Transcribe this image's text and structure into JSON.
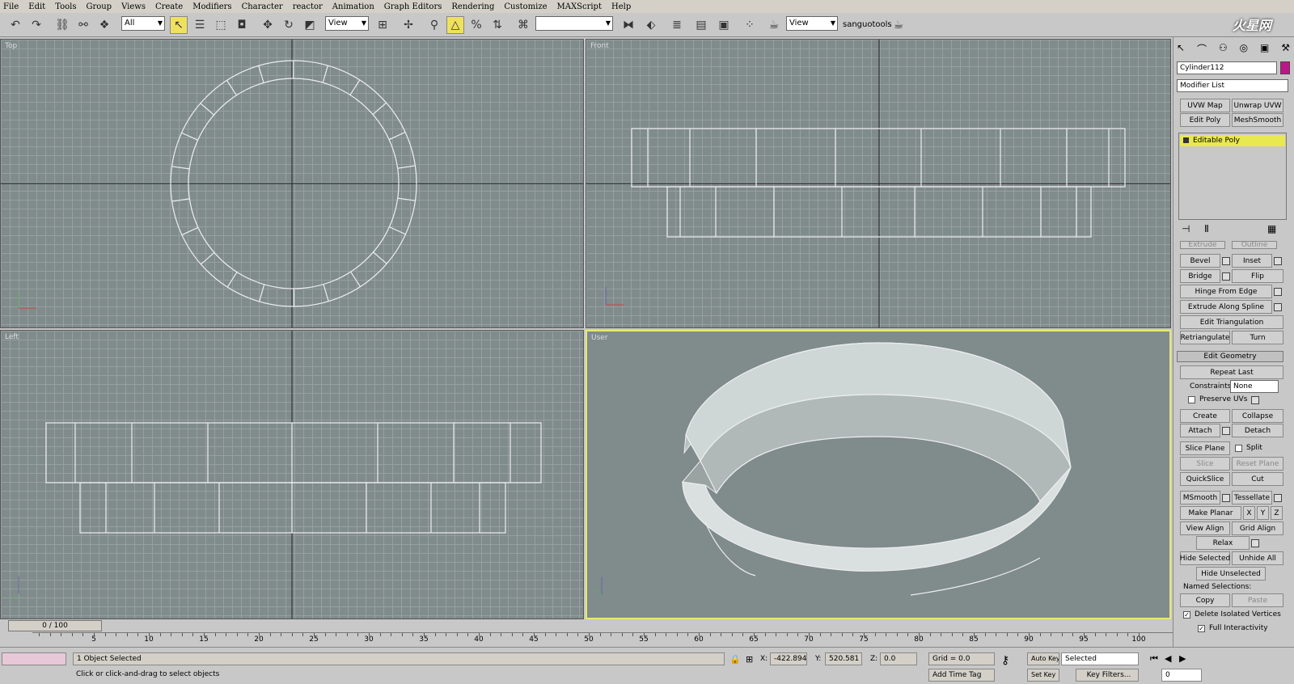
{
  "menu": [
    "File",
    "Edit",
    "Tools",
    "Group",
    "Views",
    "Create",
    "Modifiers",
    "Character",
    "reactor",
    "Animation",
    "Graph Editors",
    "Rendering",
    "Customize",
    "MAXScript",
    "Help"
  ],
  "toolbar": {
    "selection_filter": "All",
    "ref_coord": "View",
    "named_sel": "",
    "render_view": "View",
    "user": "sanguotools"
  },
  "logo_text": "火星网",
  "viewports": {
    "top": "Top",
    "front": "Front",
    "left": "Left",
    "user": "User"
  },
  "command_panel": {
    "object_name": "Cylinder112",
    "object_color": "#c0158a",
    "modifier_list": "Modifier List",
    "modifier_buttons": [
      "UVW Map",
      "Unwrap UVW",
      "Edit Poly",
      "MeshSmooth"
    ],
    "stack_item": "Editable Poly",
    "edit_edges": {
      "row0": [
        "Extrude",
        "Outline"
      ],
      "bevel": "Bevel",
      "inset": "Inset",
      "bridge": "Bridge",
      "flip": "Flip",
      "hinge": "Hinge From Edge",
      "extrude_spline": "Extrude Along Spline",
      "edit_tri": "Edit Triangulation",
      "retriangulate": "Retriangulate",
      "turn": "Turn"
    },
    "edit_geometry": {
      "header": "Edit Geometry",
      "repeat_last": "Repeat Last",
      "constraints_label": "Constraints:",
      "constraints_value": "None",
      "preserve_uvs": "Preserve UVs",
      "create": "Create",
      "collapse": "Collapse",
      "attach": "Attach",
      "detach": "Detach",
      "slice_plane": "Slice Plane",
      "split": "Split",
      "slice": "Slice",
      "reset_plane": "Reset Plane",
      "quickslice": "QuickSlice",
      "cut": "Cut",
      "msmooth": "MSmooth",
      "tessellate": "Tessellate",
      "make_planar": "Make Planar",
      "axes": [
        "X",
        "Y",
        "Z"
      ],
      "view_align": "View Align",
      "grid_align": "Grid Align",
      "relax": "Relax",
      "hide_selected": "Hide Selected",
      "unhide_all": "Unhide All",
      "hide_unselected": "Hide Unselected",
      "named_selections": "Named Selections:",
      "copy": "Copy",
      "paste": "Paste",
      "delete_isolated": "Delete Isolated Vertices",
      "full_interactivity": "Full Interactivity"
    }
  },
  "timeline": {
    "frame": "0 / 100",
    "ticks": [
      0,
      5,
      10,
      15,
      20,
      25,
      30,
      35,
      40,
      45,
      50,
      55,
      60,
      65,
      70,
      75,
      80,
      85,
      90,
      95,
      100
    ]
  },
  "status": {
    "selected": "1 Object Selected",
    "prompt": "Click or click-and-drag to select objects",
    "x_label": "X:",
    "x": "-422.894",
    "y_label": "Y:",
    "y": "520.581",
    "z_label": "Z:",
    "z": "0.0",
    "grid": "Grid = 0.0",
    "add_time_tag": "Add Time Tag",
    "auto_key": "Auto Key",
    "set_key": "Set Key",
    "key_mode": "Selected",
    "key_filters": "Key Filters...",
    "frame_field": "0"
  }
}
